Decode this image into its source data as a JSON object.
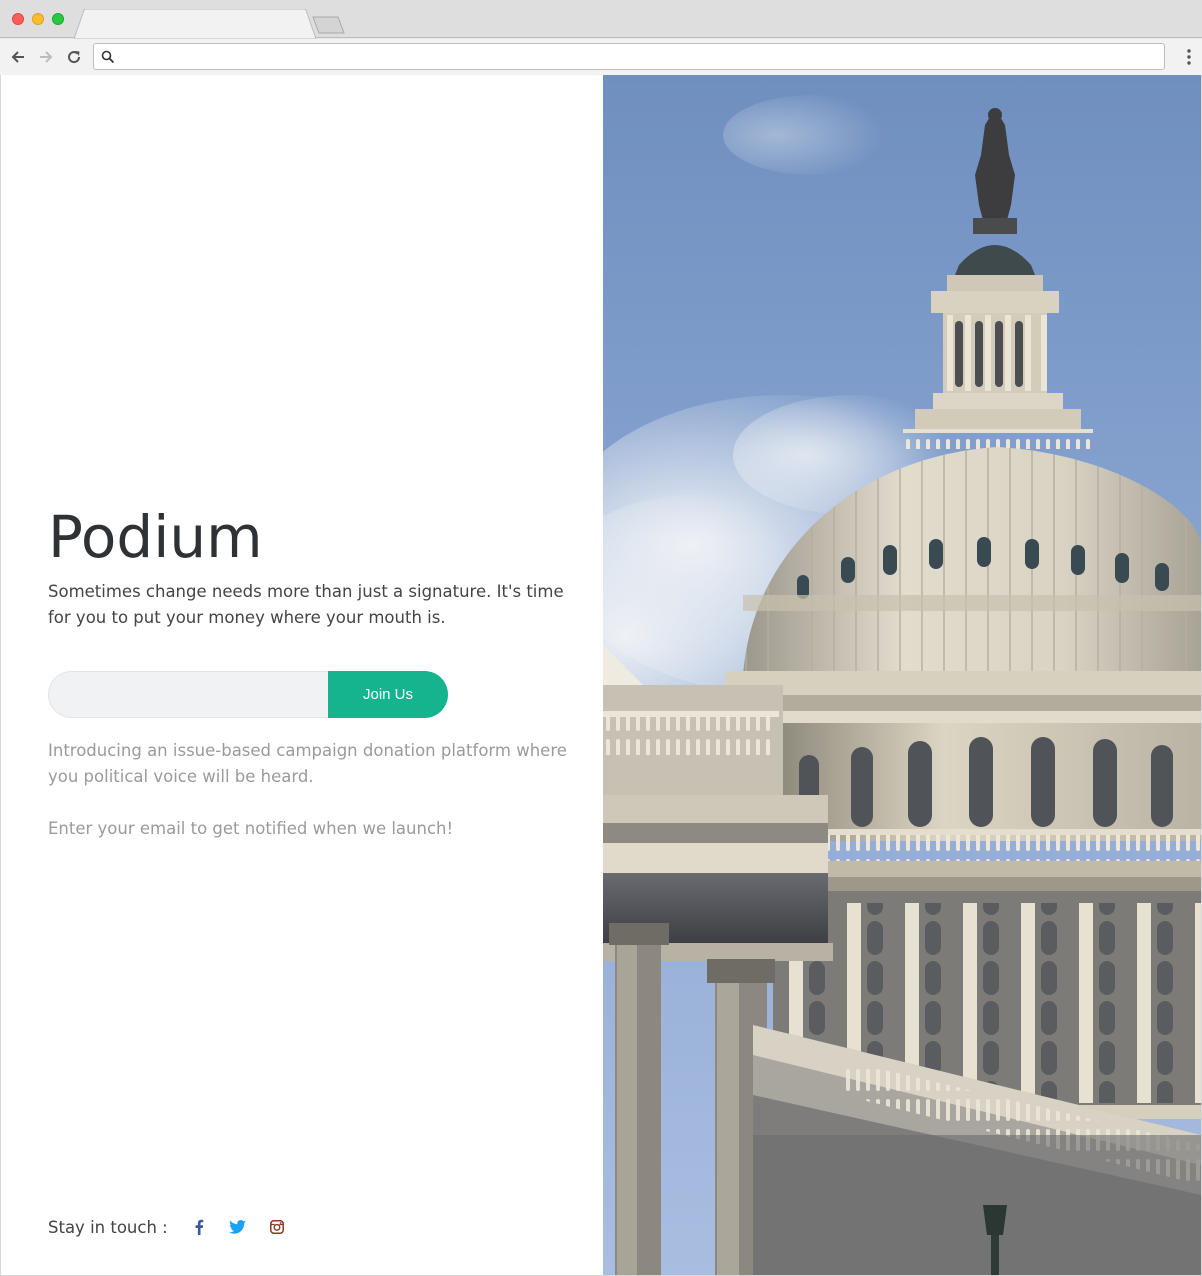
{
  "browser": {
    "tab_title": "",
    "address": "",
    "new_tab_icon": "new-tab-icon",
    "back_icon": "arrow-left-icon",
    "forward_icon": "arrow-right-icon",
    "reload_icon": "reload-icon",
    "search_icon": "magnifier-icon",
    "menu_icon": "kebab-menu-icon"
  },
  "page": {
    "title": "Podium",
    "tagline": "Sometimes change needs more than just a signature. It's time for you to put your money where your mouth is.",
    "signup": {
      "email_value": "",
      "email_placeholder": "",
      "button_label": "Join Us"
    },
    "intro": "Introducing an issue-based campaign donation platform where you political voice will be heard.",
    "notify": "Enter your email to get notified when we launch!",
    "social": {
      "label": "Stay in touch :",
      "links": [
        {
          "name": "facebook",
          "icon": "facebook-icon",
          "color": "#3b5998"
        },
        {
          "name": "twitter",
          "icon": "twitter-icon",
          "color": "#1da1f2"
        },
        {
          "name": "instagram",
          "icon": "instagram-icon",
          "color": "#8a3a22"
        }
      ]
    },
    "hero_image": "capitol-dome-photo"
  },
  "colors": {
    "accent": "#15b48f",
    "title_text": "#2f3235",
    "body_text": "#444444",
    "muted_text": "#9a9a9a",
    "input_bg": "#f1f2f4"
  }
}
